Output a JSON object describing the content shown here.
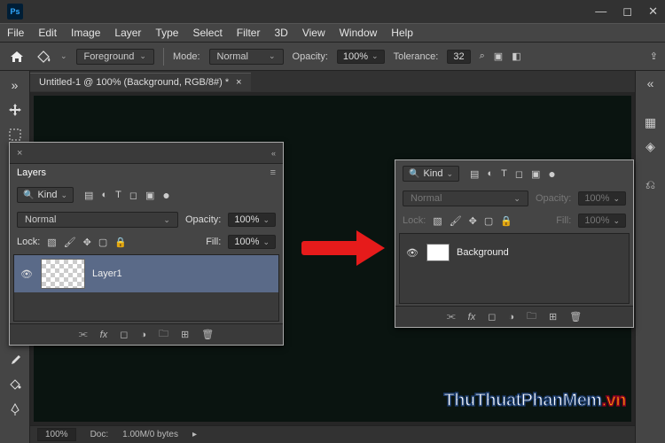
{
  "app": {
    "logo": "Ps"
  },
  "menu": [
    "File",
    "Edit",
    "Image",
    "Layer",
    "Type",
    "Select",
    "Filter",
    "3D",
    "View",
    "Window",
    "Help"
  ],
  "options": {
    "foreground": "Foreground",
    "mode_label": "Mode:",
    "mode_value": "Normal",
    "opacity_label": "Opacity:",
    "opacity_value": "100%",
    "tolerance_label": "Tolerance:",
    "tolerance_value": "32"
  },
  "doc": {
    "title": "Untitled-1 @ 100% (Background, RGB/8#) *",
    "close": "×"
  },
  "status": {
    "zoom": "100%",
    "doc_label": "Doc:",
    "doc_value": "1.00M/0 bytes"
  },
  "layers_left": {
    "title": "Layers",
    "kind": "Kind",
    "blend": "Normal",
    "opacity_label": "Opacity:",
    "opacity_value": "100%",
    "lock_label": "Lock:",
    "fill_label": "Fill:",
    "fill_value": "100%",
    "layer_name": "Layer1"
  },
  "layers_right": {
    "kind": "Kind",
    "blend": "Normal",
    "opacity_label": "Opacity:",
    "opacity_value": "100%",
    "lock_label": "Lock:",
    "fill_label": "Fill:",
    "fill_value": "100%",
    "layer_name": "Background"
  },
  "watermark": {
    "t1": "ThuThuatPhanMem",
    "t2": ".vn"
  }
}
